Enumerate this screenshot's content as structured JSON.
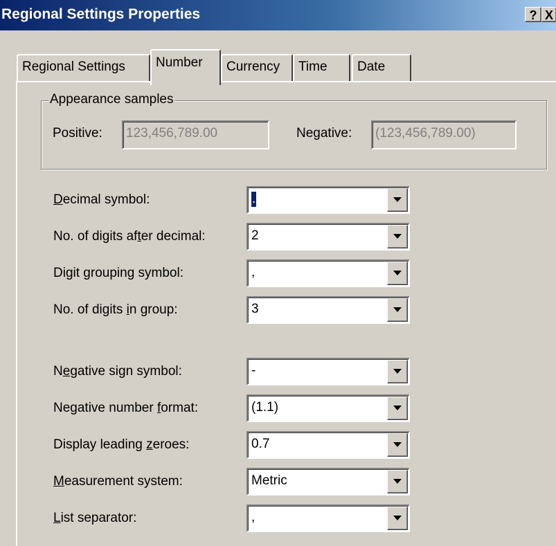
{
  "window": {
    "title": "Regional Settings Properties",
    "help_label": "?",
    "close_label": "X"
  },
  "tabs": [
    {
      "label": "Regional Settings",
      "active": false
    },
    {
      "label": "Number",
      "active": true
    },
    {
      "label": "Currency",
      "active": false
    },
    {
      "label": "Time",
      "active": false
    },
    {
      "label": "Date",
      "active": false
    }
  ],
  "samples": {
    "group_label": "Appearance samples",
    "positive_label": "Positive:",
    "positive_value": "123,456,789.00",
    "negative_label": "Negative:",
    "negative_value": "(123,456,789.00)"
  },
  "settings": [
    {
      "label_pre": "",
      "label_key": "D",
      "label_post": "ecimal symbol:",
      "value": "."
    },
    {
      "label_pre": "No. of digits af",
      "label_key": "t",
      "label_post": "er decimal:",
      "value": "2"
    },
    {
      "label_pre": "Digit ",
      "label_key": "g",
      "label_post": "rouping symbol:",
      "value": ","
    },
    {
      "label_pre": "No. of digits ",
      "label_key": "i",
      "label_post": "n group:",
      "value": "3"
    },
    {
      "label_pre": "N",
      "label_key": "e",
      "label_post": "gative sign symbol:",
      "value": "-"
    },
    {
      "label_pre": "Negative number ",
      "label_key": "f",
      "label_post": "ormat:",
      "value": "(1.1)"
    },
    {
      "label_pre": "Display leading ",
      "label_key": "z",
      "label_post": "eroes:",
      "value": "0.7"
    },
    {
      "label_pre": "",
      "label_key": "M",
      "label_post": "easurement system:",
      "value": "Metric"
    },
    {
      "label_pre": "",
      "label_key": "L",
      "label_post": "ist separator:",
      "value": ","
    }
  ],
  "colors": {
    "titlebar_start": "#0a246a",
    "titlebar_end": "#a6caf0",
    "face": "#d4d0c8",
    "selection": "#0a246a"
  },
  "icons": {
    "dropdown": "down-triangle-icon"
  }
}
